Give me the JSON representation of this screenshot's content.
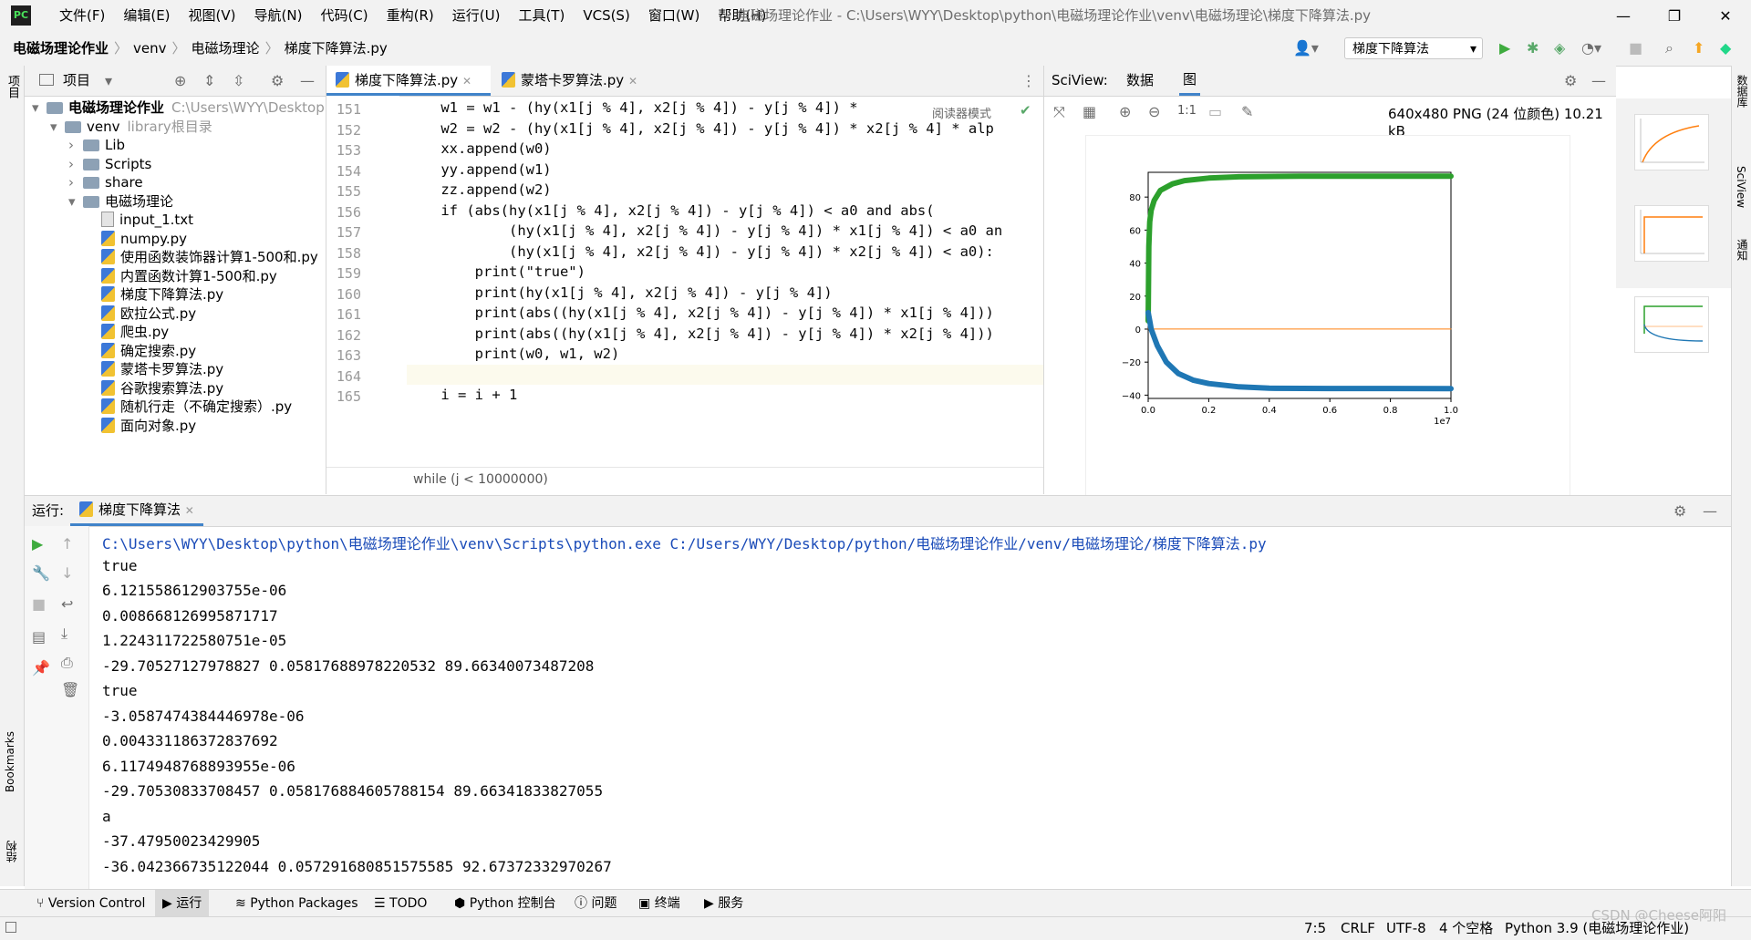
{
  "menubar": {
    "items": [
      "文件(F)",
      "编辑(E)",
      "视图(V)",
      "导航(N)",
      "代码(C)",
      "重构(R)",
      "运行(U)",
      "工具(T)",
      "VCS(S)",
      "窗口(W)",
      "帮助(H)"
    ],
    "title": "电磁场理论作业 - C:\\Users\\WYY\\Desktop\\python\\电磁场理论作业\\venv\\电磁场理论\\梯度下降算法.py"
  },
  "navbar": {
    "crumbs": [
      "电磁场理论作业",
      "venv",
      "电磁场理论",
      "梯度下降算法.py"
    ],
    "run_config": "梯度下降算法"
  },
  "project": {
    "header": "项目",
    "tree": [
      {
        "label": "电磁场理论作业",
        "hint": "C:\\Users\\WYY\\Desktop",
        "type": "folder",
        "depth": 0,
        "arrow": "▾"
      },
      {
        "label": "venv",
        "hint": "library根目录",
        "type": "folder",
        "depth": 1,
        "arrow": "▾"
      },
      {
        "label": "Lib",
        "type": "folder",
        "depth": 2,
        "arrow": "›"
      },
      {
        "label": "Scripts",
        "type": "folder",
        "depth": 2,
        "arrow": "›"
      },
      {
        "label": "share",
        "type": "folder",
        "depth": 2,
        "arrow": "›"
      },
      {
        "label": "电磁场理论",
        "type": "folder",
        "depth": 2,
        "arrow": "▾"
      },
      {
        "label": "input_1.txt",
        "type": "txt",
        "depth": 3
      },
      {
        "label": "numpy.py",
        "type": "py",
        "depth": 3
      },
      {
        "label": "使用函数装饰器计算1-500和.py",
        "type": "py",
        "depth": 3
      },
      {
        "label": "内置函数计算1-500和.py",
        "type": "py",
        "depth": 3
      },
      {
        "label": "梯度下降算法.py",
        "type": "py",
        "depth": 3
      },
      {
        "label": "欧拉公式.py",
        "type": "py",
        "depth": 3
      },
      {
        "label": "爬虫.py",
        "type": "py",
        "depth": 3
      },
      {
        "label": "确定搜索.py",
        "type": "py",
        "depth": 3
      },
      {
        "label": "蒙塔卡罗算法.py",
        "type": "py",
        "depth": 3
      },
      {
        "label": "谷歌搜索算法.py",
        "type": "py",
        "depth": 3
      },
      {
        "label": "随机行走（不确定搜索）.py",
        "type": "py",
        "depth": 3
      },
      {
        "label": "面向对象.py",
        "type": "py",
        "depth": 3
      }
    ]
  },
  "editor": {
    "tabs": [
      "梯度下降算法.py",
      "蒙塔卡罗算法.py"
    ],
    "reader_mode": "阅读器模式",
    "line_numbers": [
      "151",
      "152",
      "153",
      "154",
      "155",
      "156",
      "157",
      "158",
      "159",
      "160",
      "161",
      "162",
      "163",
      "164",
      "165"
    ],
    "lines": [
      "    w1 = w1 - (hy(x1[j % 4], x2[j % 4]) - y[j % 4]) *",
      "    w2 = w2 - (hy(x1[j % 4], x2[j % 4]) - y[j % 4]) * x2[j % 4] * alp",
      "    xx.append(w0)",
      "    yy.append(w1)",
      "    zz.append(w2)",
      "    if (abs(hy(x1[j % 4], x2[j % 4]) - y[j % 4]) < a0 and abs(",
      "            (hy(x1[j % 4], x2[j % 4]) - y[j % 4]) * x1[j % 4]) < a0 an",
      "            (hy(x1[j % 4], x2[j % 4]) - y[j % 4]) * x2[j % 4]) < a0):",
      "        print(\"true\")",
      "        print(hy(x1[j % 4], x2[j % 4]) - y[j % 4])",
      "        print(abs((hy(x1[j % 4], x2[j % 4]) - y[j % 4]) * x1[j % 4]))",
      "        print(abs((hy(x1[j % 4], x2[j % 4]) - y[j % 4]) * x2[j % 4]))",
      "        print(w0, w1, w2)",
      "",
      "    i = i + 1"
    ],
    "breadcrumb": "while (j < 10000000)"
  },
  "sciview": {
    "title": "SciView:",
    "tabs": [
      "数据",
      "图"
    ],
    "image_info": "640x480 PNG (24 位颜色) 10.21 kB",
    "zoom_label": "1:1"
  },
  "chart_data": {
    "type": "line",
    "x_multiplier_label": "1e7",
    "xlim": [
      0,
      1.0
    ],
    "ylim": [
      -42,
      95
    ],
    "x_ticks": [
      "0.0",
      "0.2",
      "0.4",
      "0.6",
      "0.8",
      "1.0"
    ],
    "y_ticks": [
      "80",
      "60",
      "40",
      "20",
      "0",
      "−20",
      "−40"
    ],
    "y_tick_values": [
      80,
      60,
      40,
      20,
      0,
      -20,
      -40
    ],
    "x_tick_values": [
      0,
      0.2,
      0.4,
      0.6,
      0.8,
      1.0
    ],
    "series": [
      {
        "color": "#2ca02c",
        "x": [
          0.0,
          0.002,
          0.005,
          0.01,
          0.02,
          0.04,
          0.08,
          0.12,
          0.2,
          0.3,
          0.5,
          1.0
        ],
        "y": [
          5,
          50,
          65,
          72,
          78,
          84,
          88,
          90,
          91.5,
          92.3,
          92.6,
          92.7
        ]
      },
      {
        "color": "#ff7f0e",
        "x": [
          0.0,
          1.0
        ],
        "y": [
          0.06,
          0.06
        ]
      },
      {
        "color": "#1f77b4",
        "x": [
          0.0,
          0.005,
          0.01,
          0.03,
          0.06,
          0.1,
          0.15,
          0.2,
          0.3,
          0.4,
          0.6,
          1.0
        ],
        "y": [
          10,
          5,
          0,
          -10,
          -20,
          -27,
          -31,
          -33,
          -35,
          -35.8,
          -36,
          -36.04
        ]
      }
    ]
  },
  "run": {
    "label": "运行:",
    "tab": "梯度下降算法",
    "output": [
      "C:\\Users\\WYY\\Desktop\\python\\电磁场理论作业\\venv\\Scripts\\python.exe C:/Users/WYY/Desktop/python/电磁场理论作业/venv/电磁场理论/梯度下降算法.py",
      "true",
      "6.121558612903755e-06",
      "0.008668126995871717",
      "1.224311722580751e-05",
      "-29.70527127978827 0.05817688978220532 89.66340073487208",
      "true",
      "-3.0587474384446978e-06",
      "0.004331186372837692",
      "6.1174948768893955e-06",
      "-29.70530833708457 0.058176884605788154 89.66341833827055",
      "a",
      "-37.47950023429905",
      "-36.042366735122044 0.057291680851575585 92.67372332970267"
    ]
  },
  "bottom_tools": [
    "Version Control",
    "运行",
    "Python Packages",
    "TODO",
    "Python 控制台",
    "问题",
    "终端",
    "服务"
  ],
  "side_labels": {
    "left_top": "项目",
    "left_bookmarks": "Bookmarks",
    "left_structure": "结构",
    "right_db": "数据库",
    "right_sciview": "SciView",
    "right_notify": "通知"
  },
  "status": {
    "position": "7:5",
    "line_sep": "CRLF",
    "encoding": "UTF-8",
    "indent": "4 个空格",
    "interpreter": "Python 3.9 (电磁场理论作业)",
    "watermark": "CSDN @Cheese阿阳"
  }
}
